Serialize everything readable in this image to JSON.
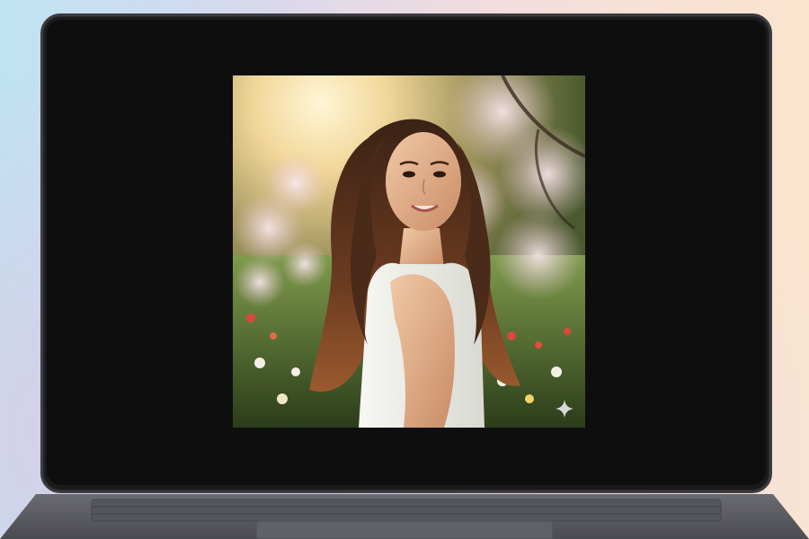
{
  "screen": {
    "content": "image-preview",
    "photo": {
      "subject": "woman-portrait-icon",
      "badge_icon": "sparkle-icon"
    }
  },
  "colors": {
    "screen_background": "#0e0e0f",
    "laptop_frame": "#3b3b40",
    "keyboard_deck": "#5b5c62"
  }
}
